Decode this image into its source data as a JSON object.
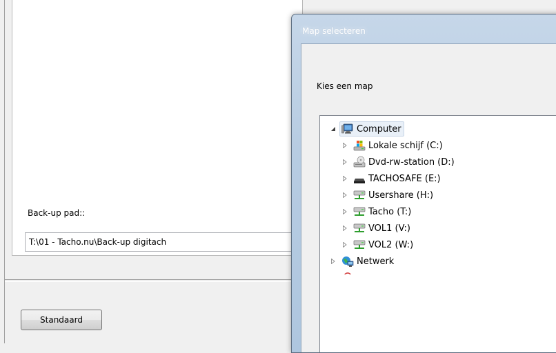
{
  "settings": {
    "backup_label": "Back-up pad::",
    "backup_path": "T:\\01 - Tacho.nu\\Back-up digitach",
    "standard_button": "Standaard"
  },
  "dialog": {
    "title": "Map selecteren",
    "instruction": "Kies een map",
    "tree": {
      "root": "Computer",
      "drives": [
        {
          "label": "Lokale schijf (C:)",
          "icon": "local-disk-icon"
        },
        {
          "label": "Dvd-rw-station (D:)",
          "icon": "dvd-drive-icon"
        },
        {
          "label": "TACHOSAFE (E:)",
          "icon": "removable-drive-icon"
        },
        {
          "label": "Usershare (H:)",
          "icon": "network-drive-icon"
        },
        {
          "label": "Tacho (T:)",
          "icon": "network-drive-icon"
        },
        {
          "label": "VOL1 (V:)",
          "icon": "network-drive-icon"
        },
        {
          "label": "VOL2 (W:)",
          "icon": "network-drive-icon"
        }
      ],
      "network": "Netwerk"
    }
  },
  "colors": {
    "window_bg": "#f0f0f0",
    "dialog_frame": "#b7cce2",
    "selection": "#e9f0f8"
  }
}
